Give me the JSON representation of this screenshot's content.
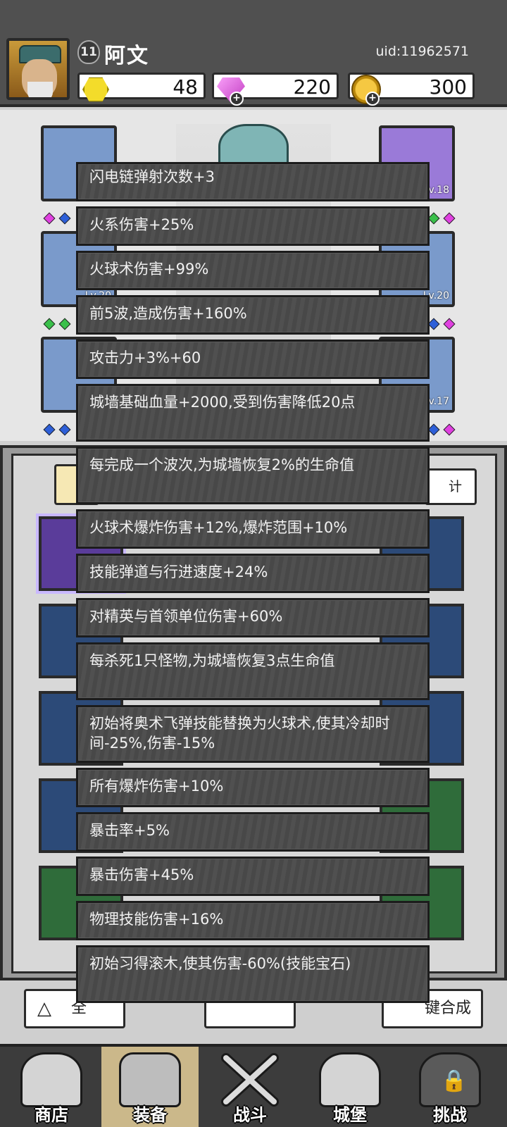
{
  "player": {
    "name": "阿文",
    "level": "11",
    "uid": "uid:11962571"
  },
  "resources": {
    "gold": "48",
    "gems": "220",
    "coins": "300"
  },
  "equipment": {
    "slots": [
      {
        "level": ""
      },
      {
        "level": "Lv.18"
      },
      {
        "level": "Lv.20"
      },
      {
        "level": "Lv.20"
      },
      {
        "level": ""
      },
      {
        "level": "Lv.17"
      }
    ]
  },
  "panel": {
    "stat_button": "计"
  },
  "actions": {
    "left": "全",
    "middle": "",
    "right": "键合成"
  },
  "stats": [
    "闪电链弹射次数+3",
    "火系伤害+25%",
    "火球术伤害+99%",
    "前5波,造成伤害+160%",
    "攻击力+3%+60",
    "城墙基础血量+2000,受到伤害降低20点",
    "每完成一个波次,为城墙恢复2%的生命值",
    "火球术爆炸伤害+12%,爆炸范围+10%",
    "技能弹道与行进速度+24%",
    "对精英与首领单位伤害+60%",
    "每杀死1只怪物,为城墙恢复3点生命值",
    "初始将奥术飞弹技能替换为火球术,使其冷却时间-25%,伤害-15%",
    "所有爆炸伤害+10%",
    "暴击率+5%",
    "暴击伤害+45%",
    "物理技能伤害+16%",
    "初始习得滚木,使其伤害-60%(技能宝石)"
  ],
  "nav": {
    "shop": "商店",
    "equipment": "装备",
    "battle": "战斗",
    "castle": "城堡",
    "challenge": "挑战"
  },
  "colors": {
    "stat_bg": "#4a4a4a",
    "header_bg": "#505050",
    "nav_active": "#cbb88a"
  }
}
